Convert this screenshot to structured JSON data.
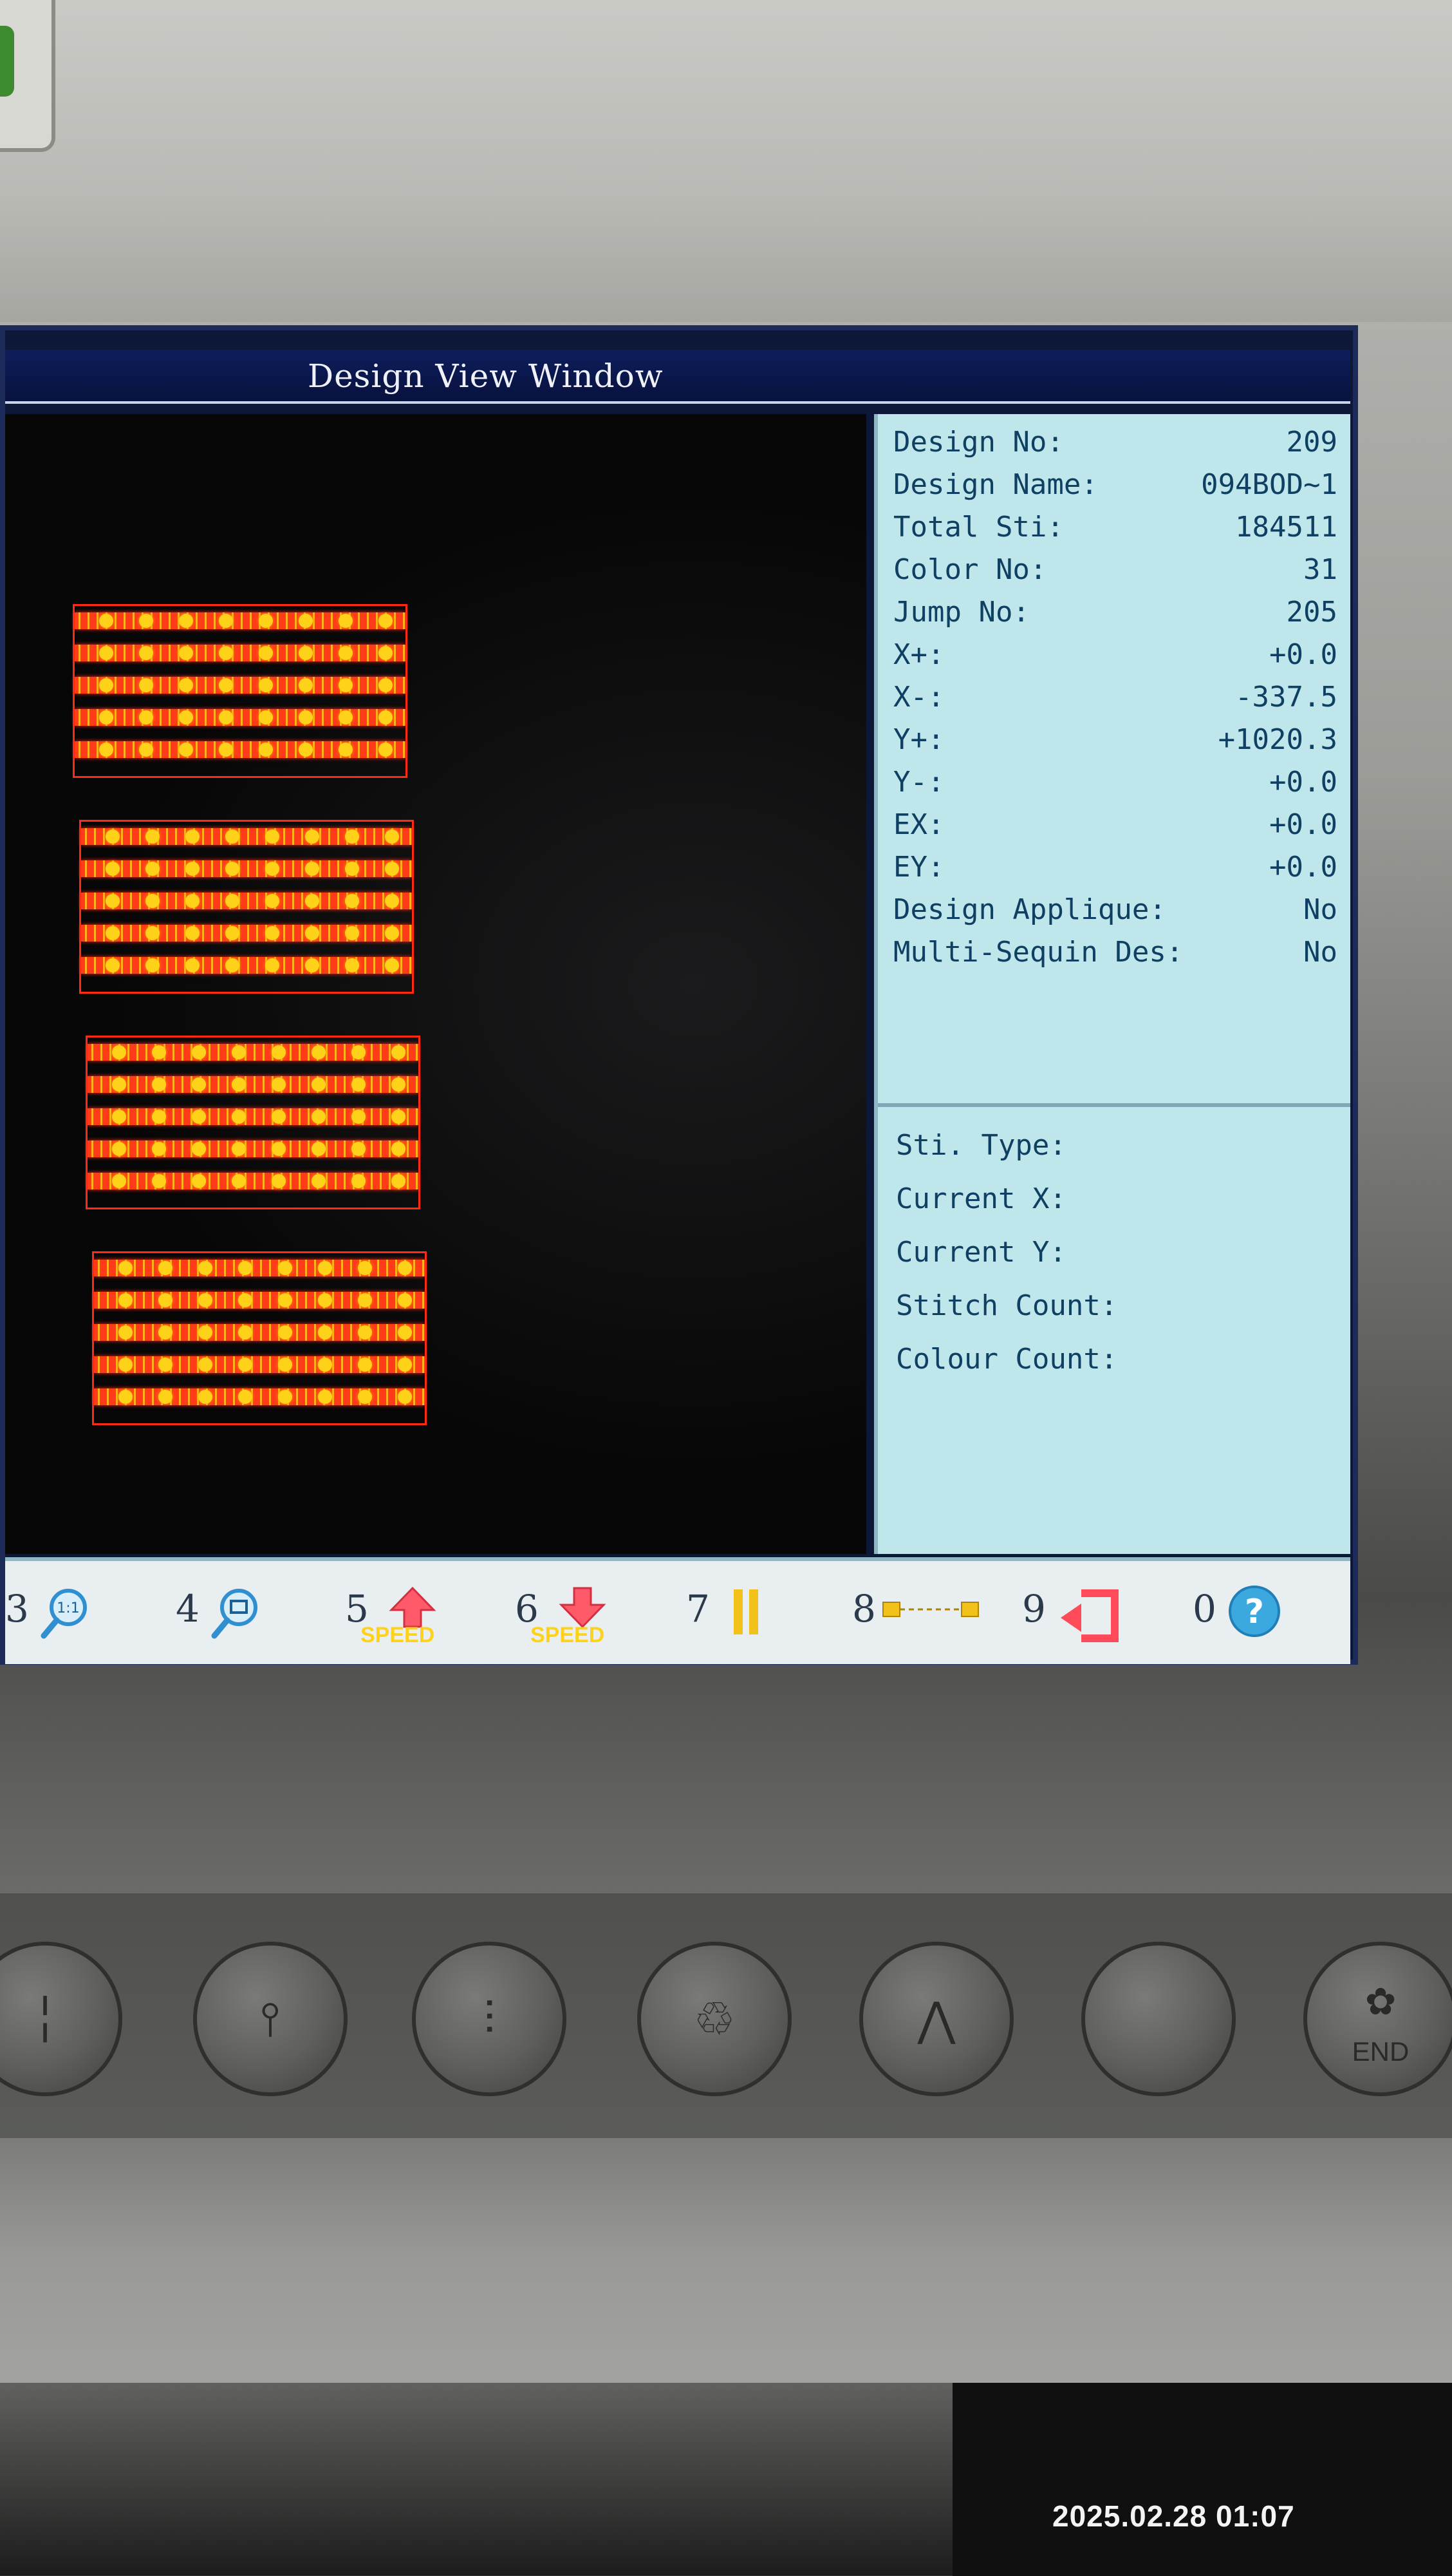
{
  "window": {
    "title": "Design View Window"
  },
  "design_info": [
    {
      "label": "Design No:",
      "value": "209"
    },
    {
      "label": "Design Name:",
      "value": "094BOD~1"
    },
    {
      "label": "Total Sti:",
      "value": "184511"
    },
    {
      "label": "Color No:",
      "value": "31"
    },
    {
      "label": "Jump No:",
      "value": "205"
    },
    {
      "label": "X+:",
      "value": "+0.0"
    },
    {
      "label": "X-:",
      "value": "-337.5"
    },
    {
      "label": "Y+:",
      "value": "+1020.3"
    },
    {
      "label": "Y-:",
      "value": "+0.0"
    },
    {
      "label": "EX:",
      "value": "+0.0"
    },
    {
      "label": "EY:",
      "value": "+0.0"
    },
    {
      "label": "Design Applique:",
      "value": "No"
    },
    {
      "label": "Multi-Sequin Des:",
      "value": "No"
    }
  ],
  "stitch_status": [
    {
      "label": "Sti. Type:"
    },
    {
      "label": "Current X:"
    },
    {
      "label": "Current Y:"
    },
    {
      "label": "Stitch Count:"
    },
    {
      "label": "Colour Count:"
    }
  ],
  "function_keys": [
    {
      "num": "3",
      "icon": "zoom-1to1-icon"
    },
    {
      "num": "4",
      "icon": "zoom-window-icon"
    },
    {
      "num": "5",
      "icon": "speed-up-icon",
      "sub": "SPEED"
    },
    {
      "num": "6",
      "icon": "speed-down-icon",
      "sub": "SPEED"
    },
    {
      "num": "7",
      "icon": "pause-icon"
    },
    {
      "num": "8",
      "icon": "frame-move-icon"
    },
    {
      "num": "9",
      "icon": "return-icon"
    },
    {
      "num": "0",
      "icon": "help-icon"
    }
  ],
  "hardware_buttons": [
    {
      "icon": "needle-select-icon"
    },
    {
      "icon": "needle-1-icon"
    },
    {
      "icon": "needle-multi-icon"
    },
    {
      "icon": "recycle-icon"
    },
    {
      "icon": "presser-foot-icon"
    },
    {
      "icon": "blank-icon"
    },
    {
      "icon": "end-icon",
      "label": "END"
    }
  ],
  "photo": {
    "timestamp": "2025.02.28 01:07"
  },
  "colors": {
    "panel": "#bfe6ea",
    "panel_text": "#0f3f62",
    "stitch_red": "#ff2a14",
    "stitch_yellow": "#ffd21a",
    "title_bar": "#0a1648"
  }
}
